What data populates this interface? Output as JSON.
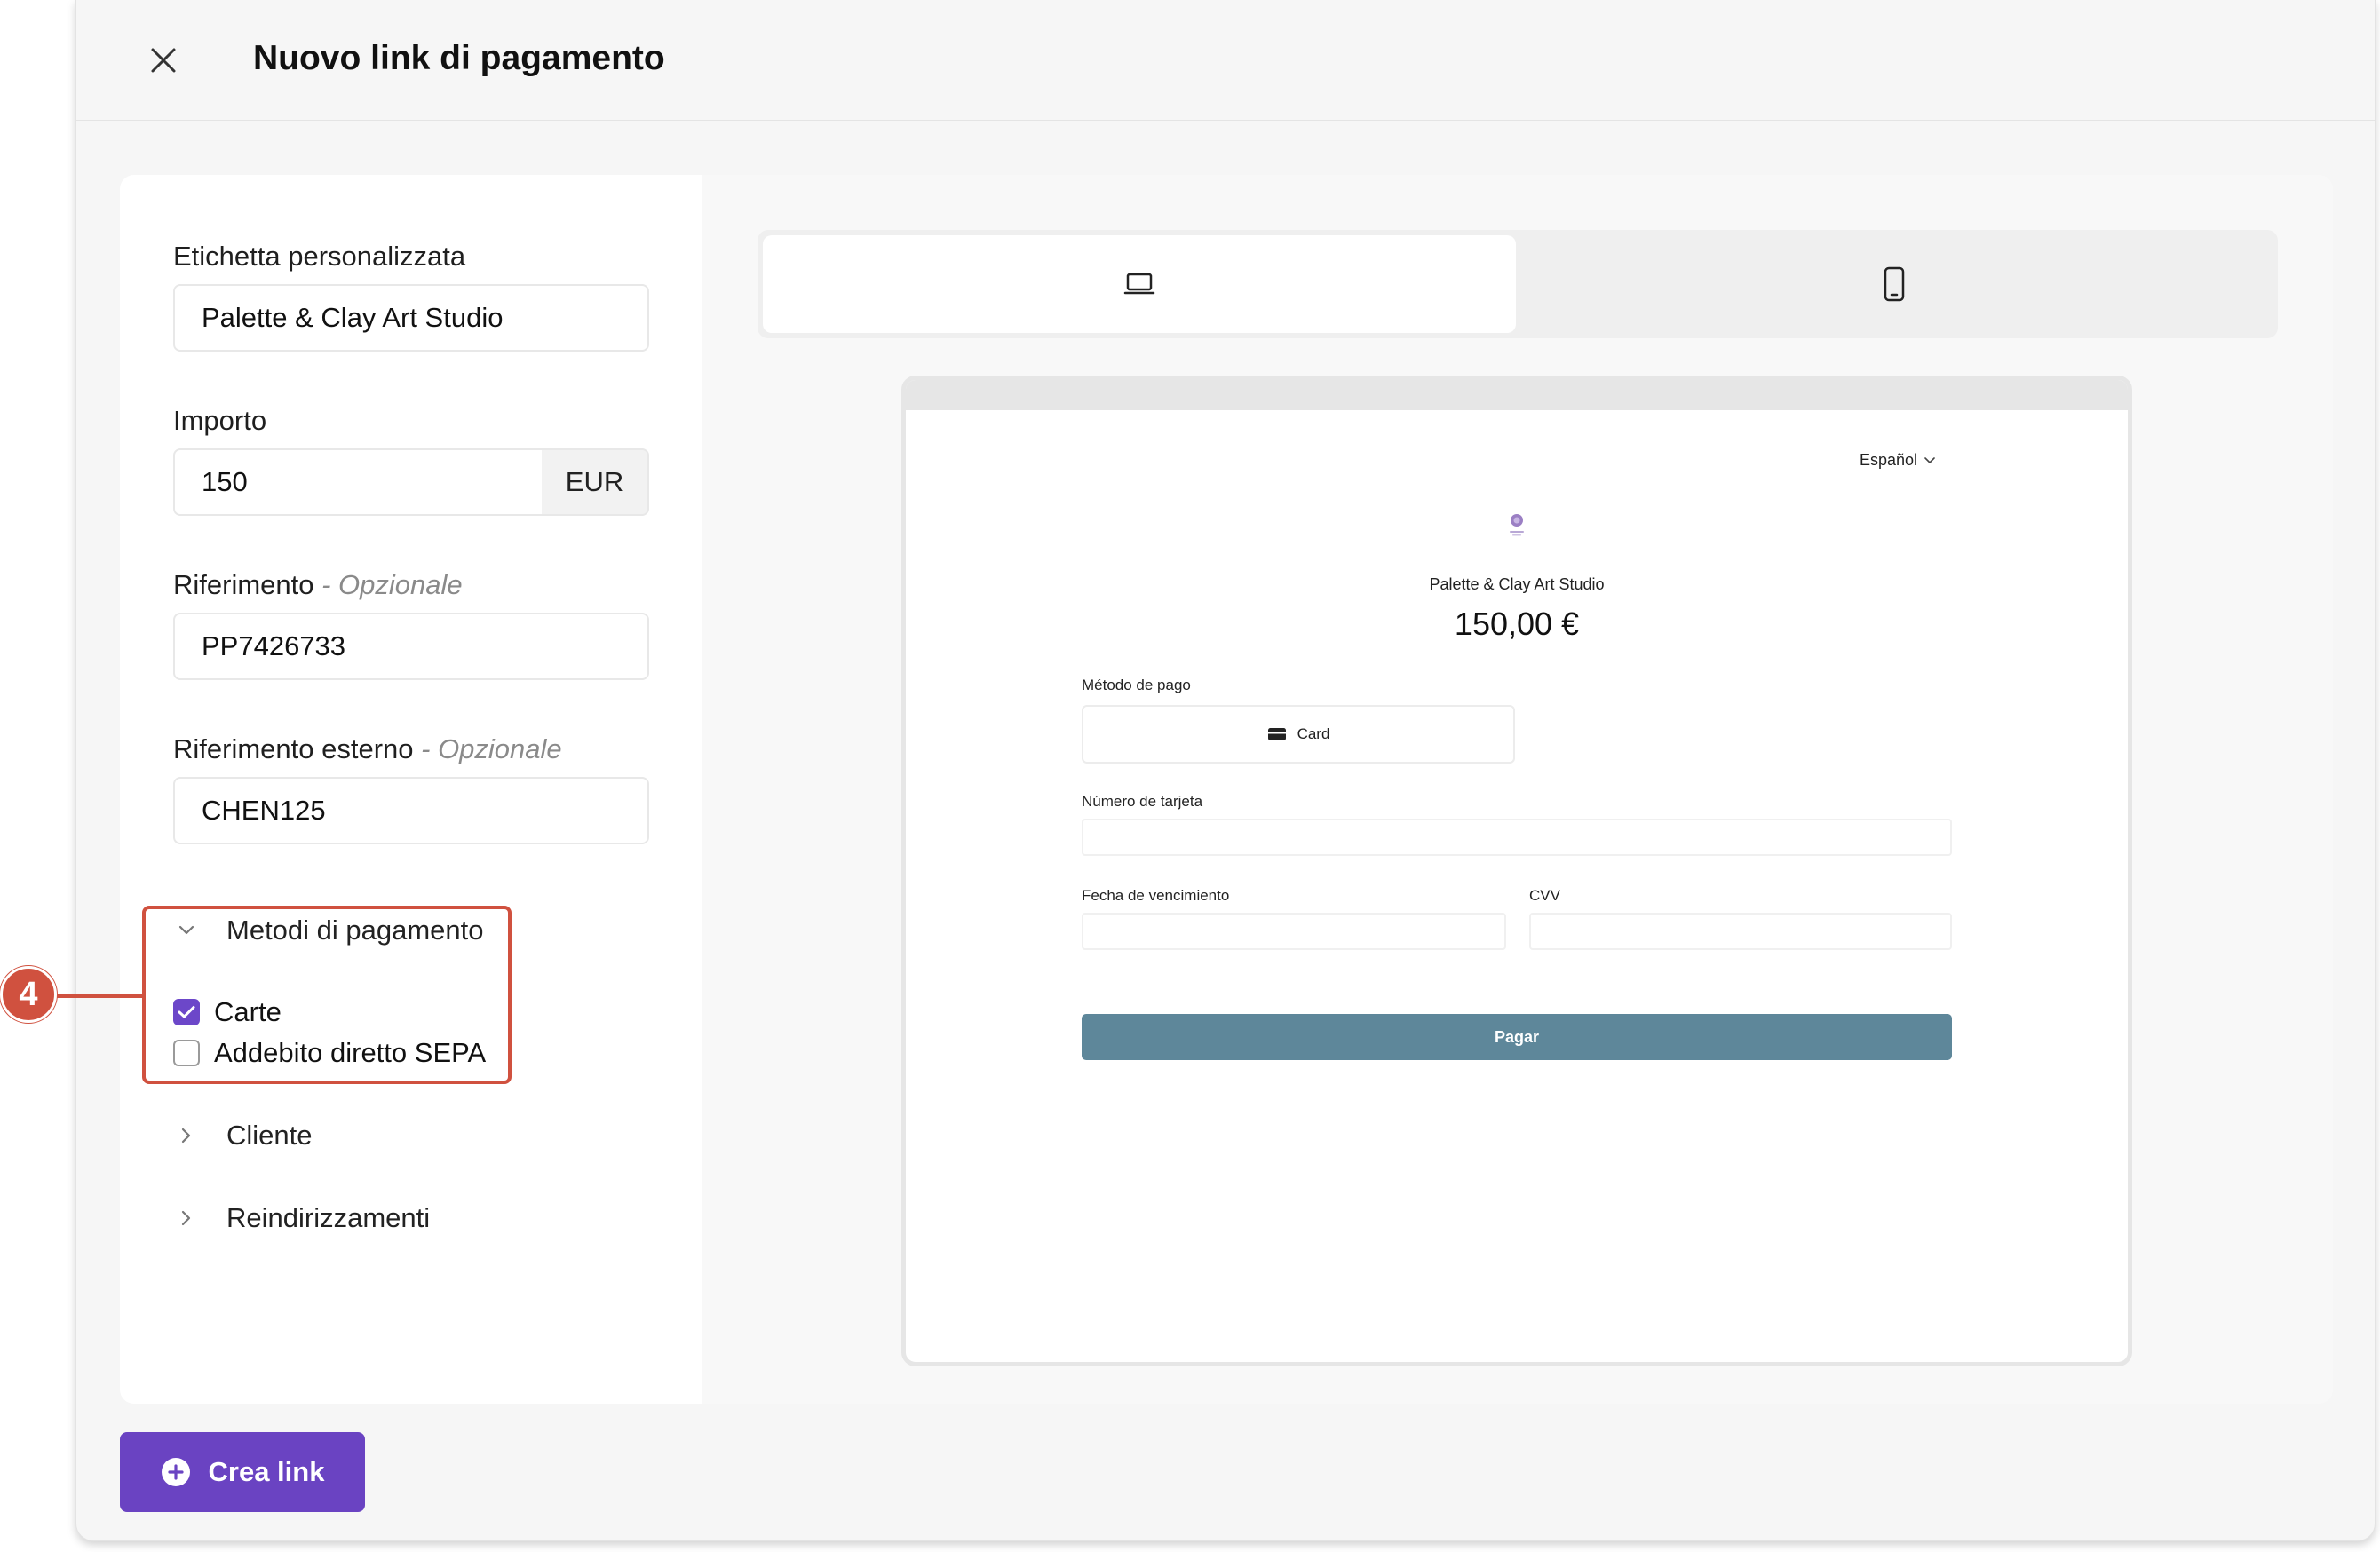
{
  "header": {
    "title": "Nuovo link di pagamento"
  },
  "form": {
    "label_field": {
      "label": "Etichetta personalizzata",
      "value": "Palette & Clay Art Studio"
    },
    "amount_field": {
      "label": "Importo",
      "value": "150",
      "currency": "EUR"
    },
    "reference_field": {
      "label": "Riferimento",
      "optional": " - Opzionale",
      "value": "PP7426733"
    },
    "external_reference_field": {
      "label": "Riferimento esterno",
      "optional": " - Opzionale",
      "value": "CHEN125"
    },
    "payment_methods": {
      "title": "Metodi di pagamento",
      "options": [
        {
          "label": "Carte",
          "checked": true
        },
        {
          "label": "Addebito diretto SEPA",
          "checked": false
        }
      ]
    },
    "customer_section": {
      "title": "Cliente"
    },
    "redirects_section": {
      "title": "Reindirizzamenti"
    }
  },
  "callout": {
    "number": "4",
    "color": "#d0513f"
  },
  "preview": {
    "language": "Español",
    "merchant_name": "Palette & Clay Art Studio",
    "amount": "150,00 €",
    "payment_method_label": "Método de pago",
    "card_option": "Card",
    "card_number_label": "Número de tarjeta",
    "expiry_label": "Fecha de vencimiento",
    "cvv_label": "CVV",
    "pay_button": "Pagar",
    "pay_button_color": "#5e879a"
  },
  "footer": {
    "create_button": "Crea link",
    "accent_color": "#6a43c2"
  }
}
